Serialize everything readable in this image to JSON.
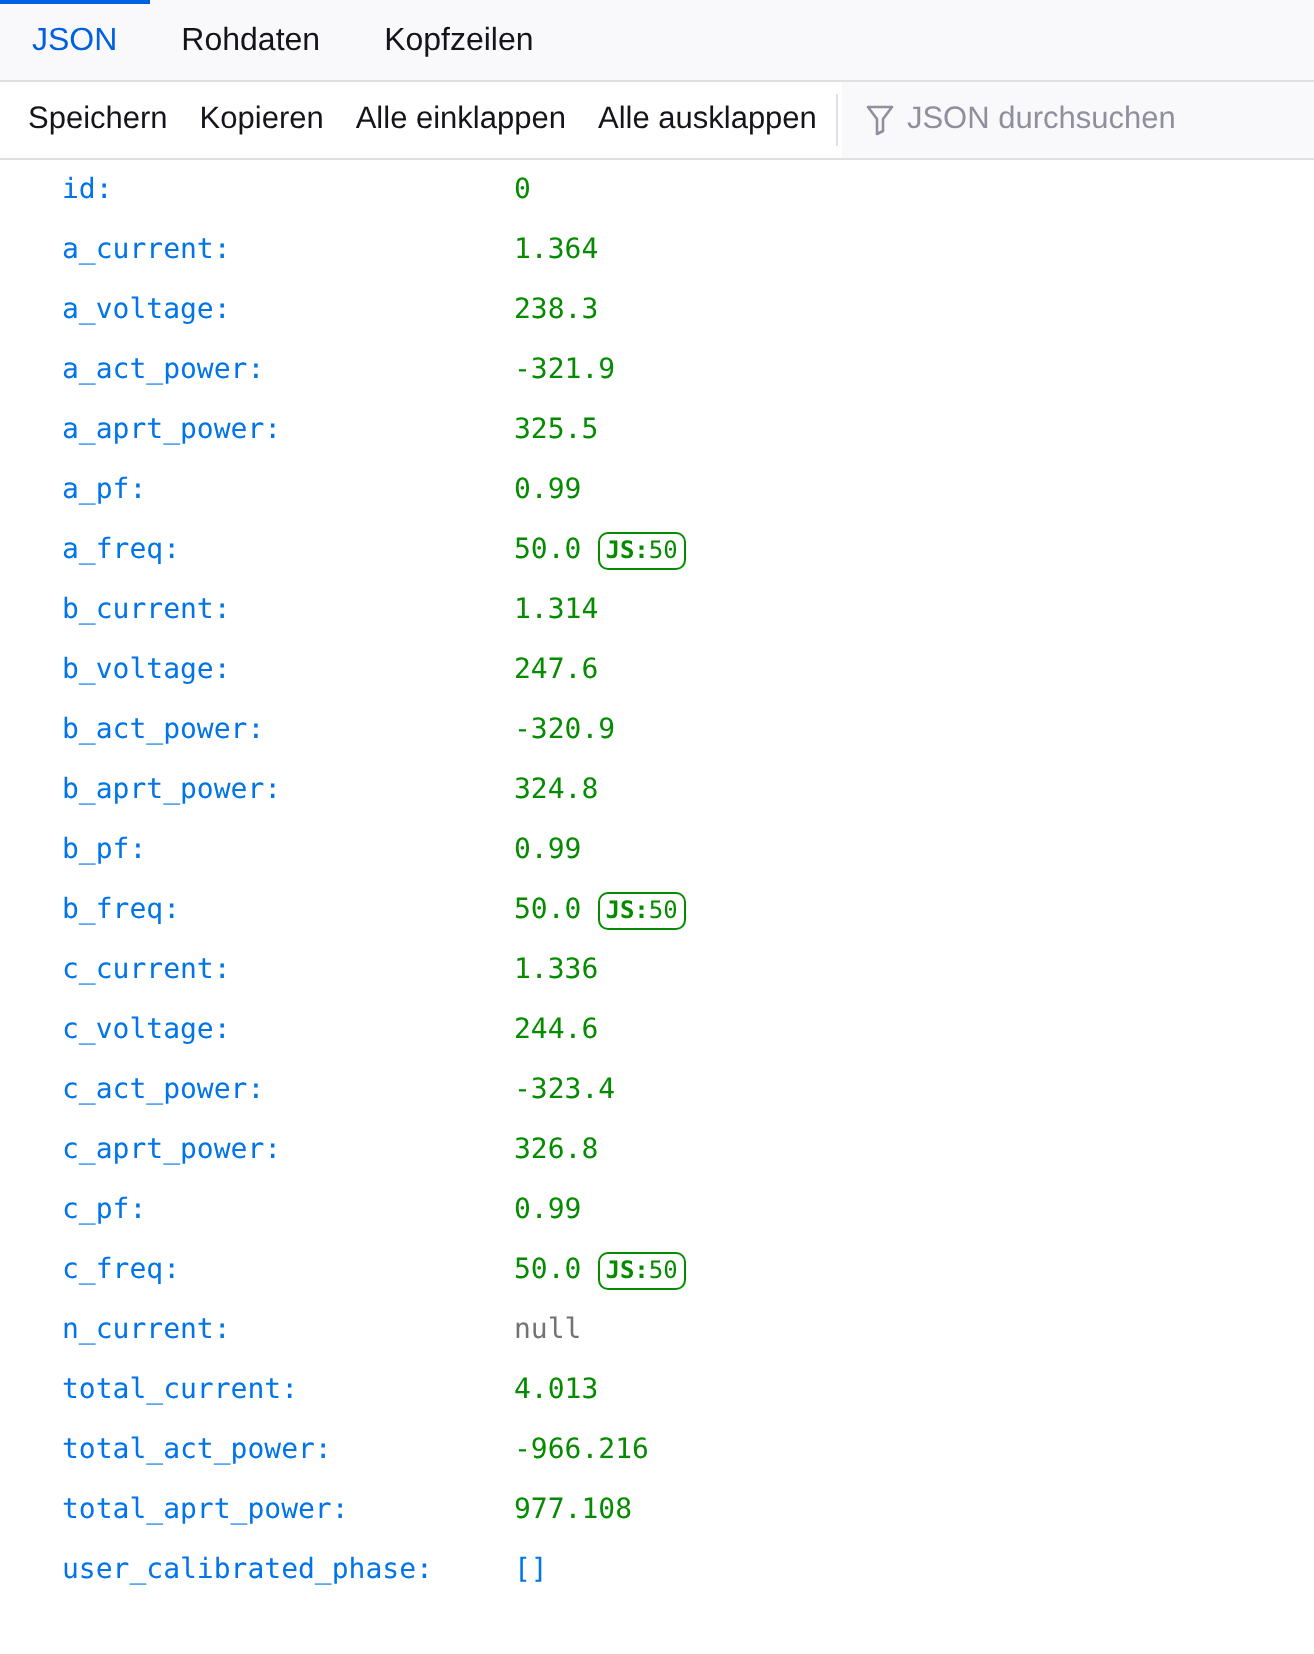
{
  "tabs": [
    {
      "label": "JSON",
      "selected": true
    },
    {
      "label": "Rohdaten",
      "selected": false
    },
    {
      "label": "Kopfzeilen",
      "selected": false
    }
  ],
  "toolbar": {
    "buttons": [
      "Speichern",
      "Kopieren",
      "Alle einklappen",
      "Alle ausklappen"
    ],
    "filter": {
      "placeholder": "JSON durchsuchen"
    }
  },
  "rows": [
    {
      "key": "id:",
      "value": "0",
      "kind": "number"
    },
    {
      "key": "a_current:",
      "value": "1.364",
      "kind": "number"
    },
    {
      "key": "a_voltage:",
      "value": "238.3",
      "kind": "number"
    },
    {
      "key": "a_act_power:",
      "value": "-321.9",
      "kind": "number"
    },
    {
      "key": "a_aprt_power:",
      "value": "325.5",
      "kind": "number"
    },
    {
      "key": "a_pf:",
      "value": "0.99",
      "kind": "number"
    },
    {
      "key": "a_freq:",
      "value": "50.0",
      "kind": "number",
      "badge": "**JS:**50"
    },
    {
      "key": "b_current:",
      "value": "1.314",
      "kind": "number"
    },
    {
      "key": "b_voltage:",
      "value": "247.6",
      "kind": "number"
    },
    {
      "key": "b_act_power:",
      "value": "-320.9",
      "kind": "number"
    },
    {
      "key": "b_aprt_power:",
      "value": "324.8",
      "kind": "number"
    },
    {
      "key": "b_pf:",
      "value": "0.99",
      "kind": "number"
    },
    {
      "key": "b_freq:",
      "value": "50.0",
      "kind": "number",
      "badge": "**JS:**50"
    },
    {
      "key": "c_current:",
      "value": "1.336",
      "kind": "number"
    },
    {
      "key": "c_voltage:",
      "value": "244.6",
      "kind": "number"
    },
    {
      "key": "c_act_power:",
      "value": "-323.4",
      "kind": "number"
    },
    {
      "key": "c_aprt_power:",
      "value": "326.8",
      "kind": "number"
    },
    {
      "key": "c_pf:",
      "value": "0.99",
      "kind": "number"
    },
    {
      "key": "c_freq:",
      "value": "50.0",
      "kind": "number",
      "badge": "**JS:**50"
    },
    {
      "key": "n_current:",
      "value": "null",
      "kind": "null"
    },
    {
      "key": "total_current:",
      "value": "4.013",
      "kind": "number"
    },
    {
      "key": "total_act_power:",
      "value": "-966.216",
      "kind": "number"
    },
    {
      "key": "total_aprt_power:",
      "value": "977.108",
      "kind": "number"
    },
    {
      "key": "user_calibrated_phase:",
      "value": "[]",
      "kind": "array"
    }
  ]
}
